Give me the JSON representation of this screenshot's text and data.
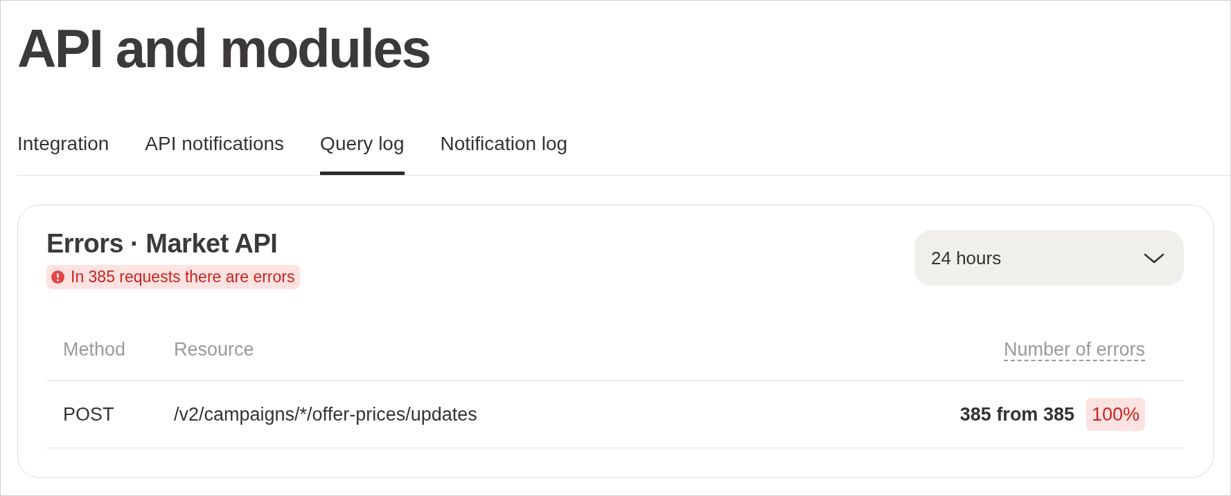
{
  "page": {
    "title": "API and modules"
  },
  "tabs": [
    {
      "label": "Integration",
      "selected": false
    },
    {
      "label": "API notifications",
      "selected": false
    },
    {
      "label": "Query log",
      "selected": true
    },
    {
      "label": "Notification log",
      "selected": false
    }
  ],
  "errors_card": {
    "title": "Errors · Market API",
    "alert": "In 385 requests there are errors",
    "period": {
      "value": "24 hours"
    },
    "table": {
      "columns": [
        "Method",
        "Resource",
        "Number of errors"
      ],
      "rows": [
        {
          "method": "POST",
          "resource": "/v2/campaigns/*/offer-prices/updates",
          "errors": "385 from 385",
          "share": "100%"
        }
      ]
    }
  }
}
